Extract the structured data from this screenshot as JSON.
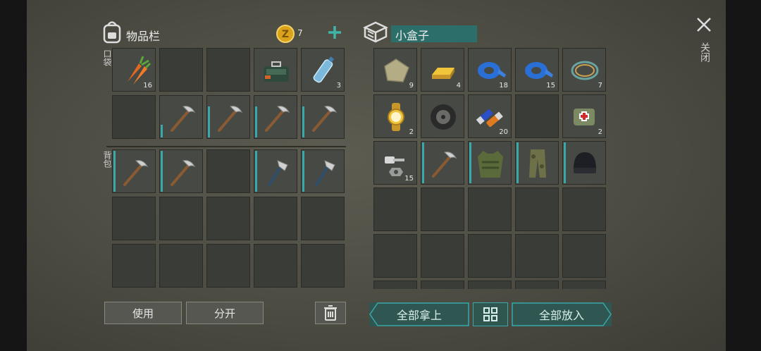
{
  "inventory": {
    "title": "物品栏",
    "coins": "7",
    "pocket_label": "口袋",
    "backpack_label": "背包",
    "pocket_slots": [
      {
        "item": "carrot-icon",
        "count": "16"
      },
      {
        "item": "",
        "count": ""
      },
      {
        "item": "",
        "count": ""
      },
      {
        "item": "toolbox-icon",
        "count": ""
      },
      {
        "item": "water-bottle-icon",
        "count": "3"
      },
      {
        "item": "",
        "count": ""
      },
      {
        "item": "pickaxe-icon",
        "count": ""
      },
      {
        "item": "pickaxe-icon",
        "count": ""
      },
      {
        "item": "pickaxe-icon",
        "count": ""
      },
      {
        "item": "pickaxe-icon",
        "count": ""
      }
    ],
    "backpack_slots": [
      {
        "item": "pickaxe-icon",
        "count": ""
      },
      {
        "item": "pickaxe-icon",
        "count": ""
      },
      {
        "item": "",
        "count": ""
      },
      {
        "item": "axe-icon",
        "count": ""
      },
      {
        "item": "axe-icon",
        "count": ""
      }
    ],
    "use_label": "使用",
    "split_label": "分开"
  },
  "container": {
    "title": "小盒子",
    "slots": [
      {
        "item": "cloth-icon",
        "count": "9"
      },
      {
        "item": "gold-bar-icon",
        "count": "4"
      },
      {
        "item": "blue-tape-icon",
        "count": "18"
      },
      {
        "item": "blue-tape-icon",
        "count": "15"
      },
      {
        "item": "wire-coil-icon",
        "count": "7"
      },
      {
        "item": "gold-watch-icon",
        "count": "2"
      },
      {
        "item": "wheel-icon",
        "count": ""
      },
      {
        "item": "battery-icon",
        "count": "20"
      },
      {
        "item": "",
        "count": ""
      },
      {
        "item": "first-aid-bag-icon",
        "count": "2"
      },
      {
        "item": "bolts-icon",
        "count": "15"
      },
      {
        "item": "pickaxe-icon",
        "count": ""
      },
      {
        "item": "armor-vest-icon",
        "count": ""
      },
      {
        "item": "camo-pants-icon",
        "count": ""
      },
      {
        "item": "beanie-icon",
        "count": ""
      }
    ],
    "take_all_label": "全部拿上",
    "put_all_label": "全部放入"
  },
  "close_label": "关闭",
  "colors": {
    "accent": "#3aa7a8",
    "background": "#4c4c43",
    "button_teal": "#2f5651"
  }
}
